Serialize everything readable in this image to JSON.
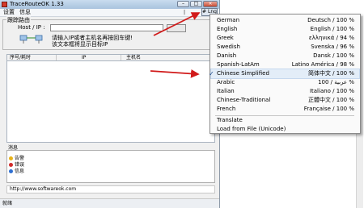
{
  "window": {
    "title": "TraceRouteOK 1.33",
    "controls": {
      "minimize": "–",
      "maximize": "□",
      "close": "×"
    }
  },
  "menu": {
    "settings": "设置",
    "info": "信息",
    "lang_button": "# Lng"
  },
  "form": {
    "group_label": "跟踪路由",
    "host_label": "Host / IP :",
    "hint_line1": "请输入IP或者主机名再按回车键!",
    "hint_line2": "该文本框将显示目标IP"
  },
  "table": {
    "columns": [
      "序号/耗时",
      "IP",
      "主机名"
    ]
  },
  "messages": {
    "title": "消息",
    "items": [
      {
        "label": "告警",
        "color": "#e8b319"
      },
      {
        "label": "错误",
        "color": "#d12b2b"
      },
      {
        "label": "信息",
        "color": "#2f6fd1"
      }
    ]
  },
  "url": "http://www.softwareok.com",
  "status": "就绪",
  "language_menu": {
    "items": [
      {
        "name": "German",
        "native": "Deutsch / 100 %"
      },
      {
        "name": "English",
        "native": "English / 100 %"
      },
      {
        "name": "Greek",
        "native": "ελληνικά / 94 %"
      },
      {
        "name": "Swedish",
        "native": "Svenska / 96 %"
      },
      {
        "name": "Danish",
        "native": "Dansk / 100 %"
      },
      {
        "name": "Spanish-LatAm",
        "native": "Latino América / 98 %"
      },
      {
        "name": "Chinese Simplified",
        "native": "简体中文 / 100 %",
        "checked": true
      },
      {
        "name": "Arabic",
        "native": "100 / عربية %"
      },
      {
        "name": "Italian",
        "native": "Italiano / 100 %"
      },
      {
        "name": "Chinese-Traditional",
        "native": "正體中文 / 100 %"
      },
      {
        "name": "French",
        "native": "Française / 100 %"
      }
    ],
    "translate": "Translate",
    "load_from_file": "Load from File (Unicode)",
    "check_mark": "✓"
  },
  "annotation_color": "#d11a1a"
}
